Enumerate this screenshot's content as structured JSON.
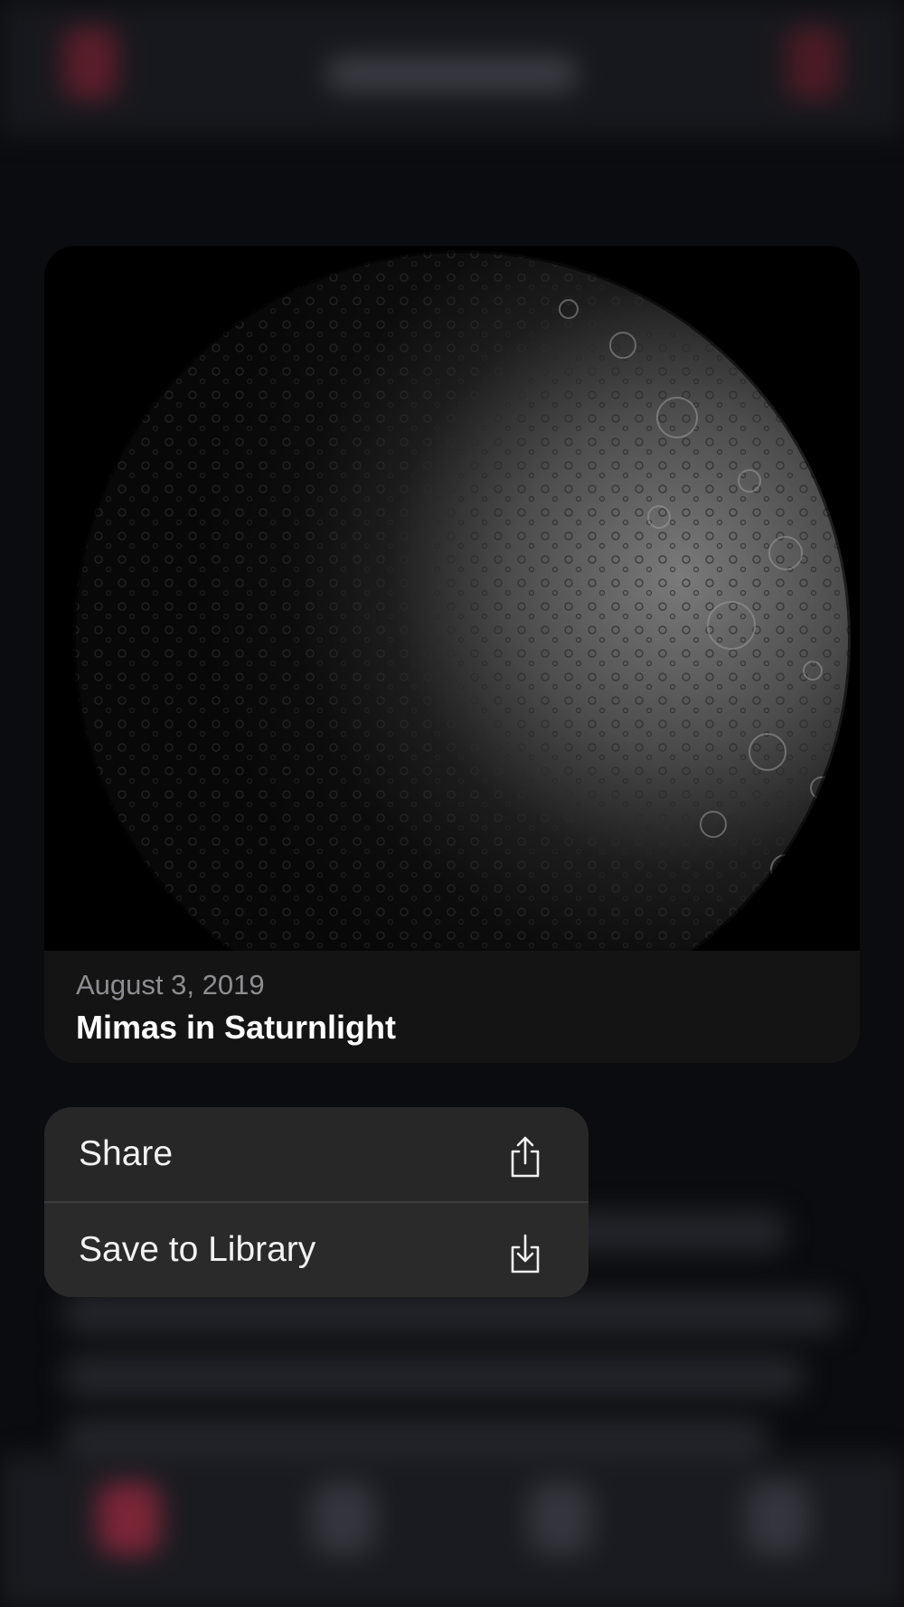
{
  "photo": {
    "date": "August 3, 2019",
    "title": "Mimas in Saturnlight"
  },
  "menu": {
    "items": [
      {
        "label": "Share",
        "icon": "share-icon"
      },
      {
        "label": "Save to Library",
        "icon": "save-to-library-icon"
      }
    ]
  },
  "colors": {
    "background": "#0b0c0f",
    "card": "#141414",
    "menu": "#272727",
    "accent": "#7a2538"
  }
}
